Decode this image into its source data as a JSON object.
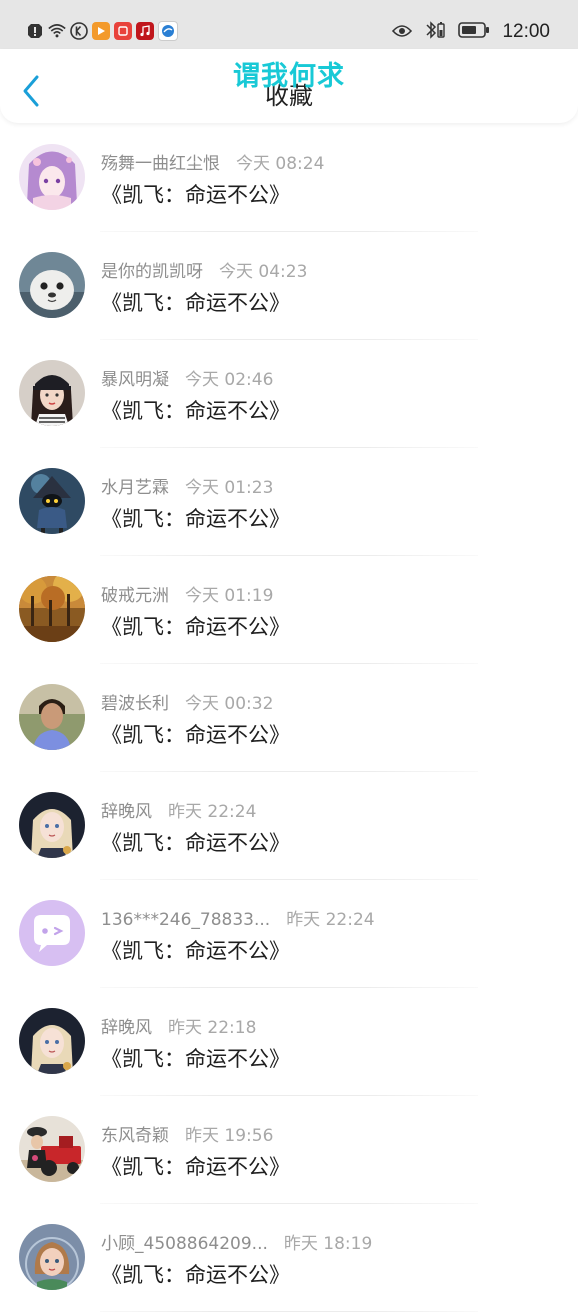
{
  "status_bar": {
    "time": "12:00",
    "left_icons": [
      "alert-icon",
      "wifi-icon",
      "k-app-icon",
      "video-app-icon",
      "red-app-icon",
      "music-app-icon",
      "browser-app-icon"
    ],
    "right_icons": [
      "eye-icon",
      "bluetooth-icon",
      "battery-icon"
    ]
  },
  "header": {
    "title": "收藏",
    "overlay_text": "谓我何求",
    "accent_color": "#1a9fd8"
  },
  "favorites": [
    {
      "name": "殇舞一曲红尘恨",
      "time": "今天 08:24",
      "content": "《凯飞：命运不公》",
      "avatar": "anime-girl-purple"
    },
    {
      "name": "是你的凯凯呀",
      "time": "今天 04:23",
      "content": "《凯飞：命运不公》",
      "avatar": "seal"
    },
    {
      "name": "暴风明凝",
      "time": "今天 02:46",
      "content": "《凯飞：命运不公》",
      "avatar": "girl-cap"
    },
    {
      "name": "水月艺霖",
      "time": "今天 01:23",
      "content": "《凯飞：命运不公》",
      "avatar": "game-character"
    },
    {
      "name": "破戒元洲",
      "time": "今天 01:19",
      "content": "《凯飞：命运不公》",
      "avatar": "autumn-forest"
    },
    {
      "name": "碧波长利",
      "time": "今天 00:32",
      "content": "《凯飞：命运不公》",
      "avatar": "boy-outdoor"
    },
    {
      "name": "辞晚风",
      "time": "昨天 22:24",
      "content": "《凯飞：命运不公》",
      "avatar": "anime-blonde"
    },
    {
      "name": "136***246_78833...",
      "time": "昨天 22:24",
      "content": "《凯飞：命运不公》",
      "avatar": "default-chat"
    },
    {
      "name": "辞晚风",
      "time": "昨天 22:18",
      "content": "《凯飞：命运不公》",
      "avatar": "anime-blonde"
    },
    {
      "name": "东风奇颖",
      "time": "昨天 19:56",
      "content": "《凯飞：命运不公》",
      "avatar": "red-tractor"
    },
    {
      "name": "小顾_4508864209...",
      "time": "昨天 18:19",
      "content": "《凯飞：命运不公》",
      "avatar": "cartoon-girl"
    }
  ]
}
